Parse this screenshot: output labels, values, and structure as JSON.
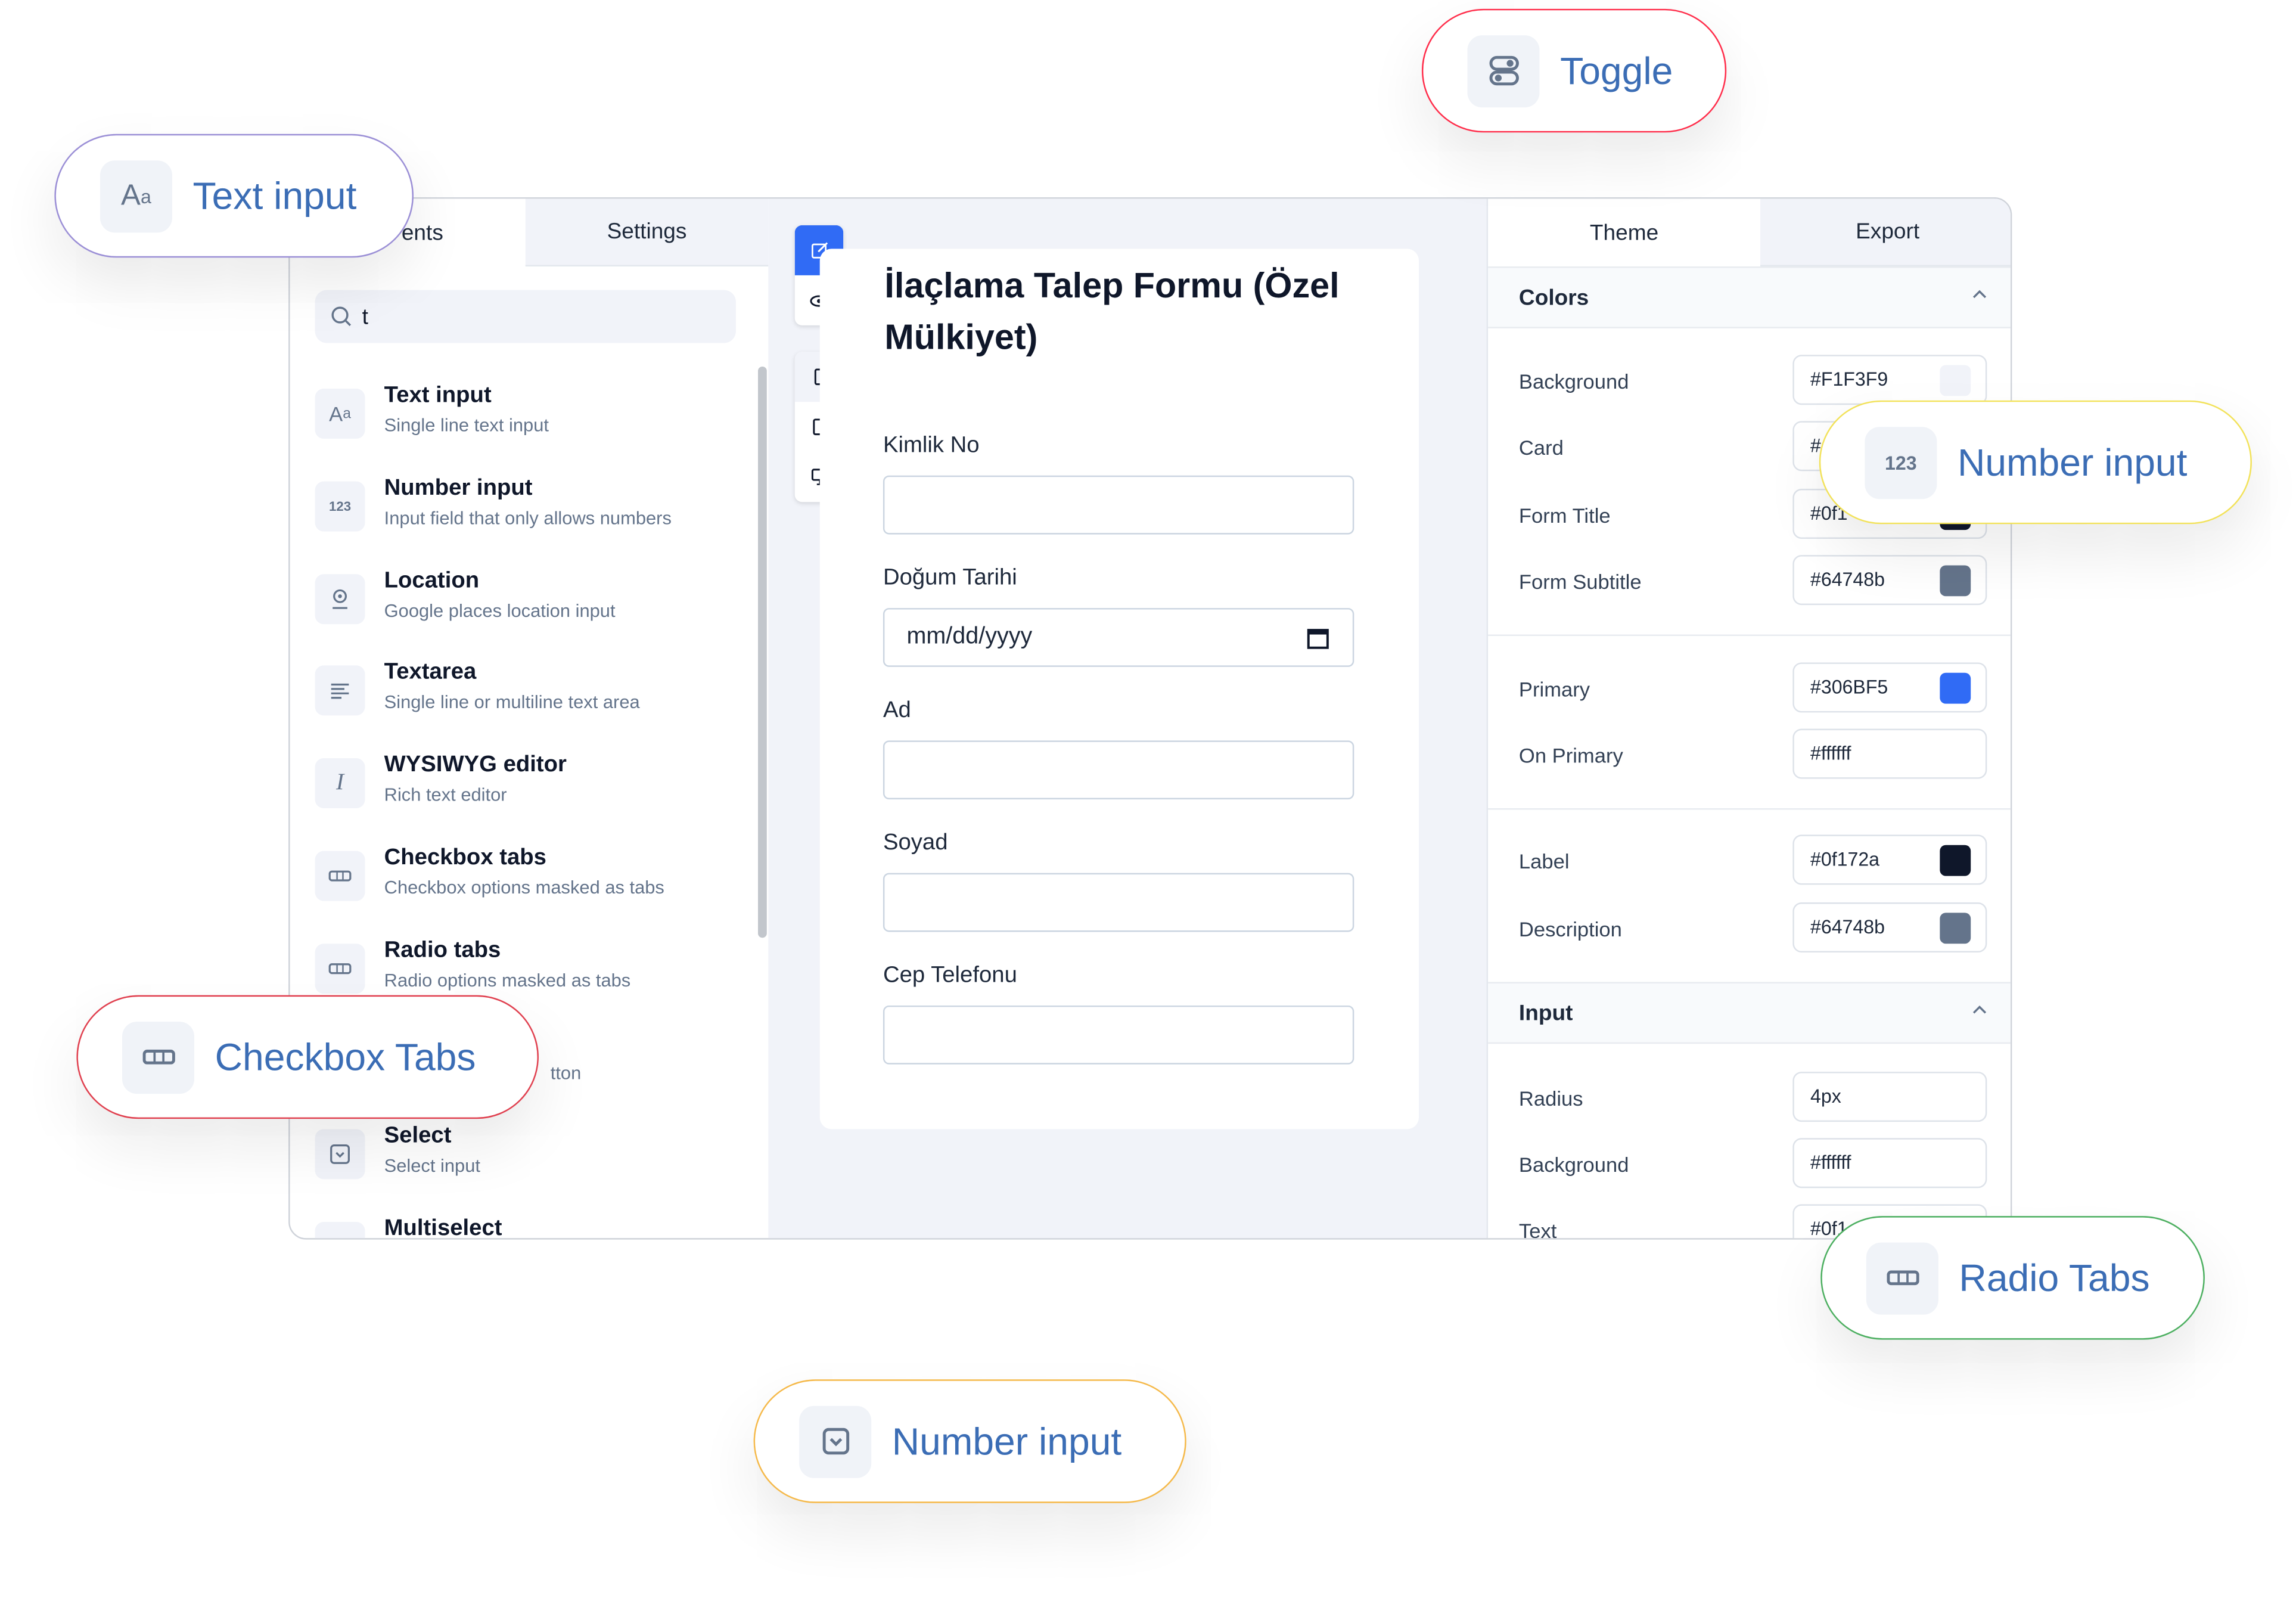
{
  "left_panel": {
    "tabs": [
      {
        "label": "ents"
      },
      {
        "label": "Settings"
      }
    ],
    "search": {
      "value": "t"
    },
    "items": [
      {
        "label": "Text input",
        "desc": "Single line text input",
        "icon": "text-aa-icon"
      },
      {
        "label": "Number input",
        "desc": "Input field that only allows numbers",
        "icon": "number-123-icon"
      },
      {
        "label": "Location",
        "desc": "Google places location input",
        "icon": "location-pin-icon"
      },
      {
        "label": "Textarea",
        "desc": "Single line or multiline text area",
        "icon": "lines-icon"
      },
      {
        "label": "WYSIWYG editor",
        "desc": "Rich text editor",
        "icon": "cursor-icon"
      },
      {
        "label": "Checkbox tabs",
        "desc": "Checkbox options masked as tabs",
        "icon": "tabs-icon"
      },
      {
        "label": "Radio tabs",
        "desc": "Radio options masked as tabs",
        "icon": "tabs-icon"
      },
      {
        "label": "",
        "desc": "tton",
        "icon": ""
      },
      {
        "label": "Select",
        "desc": "Select input",
        "icon": "select-icon"
      },
      {
        "label": "Multiselect",
        "desc": "",
        "icon": "select-icon"
      }
    ]
  },
  "toolbar": {
    "icons": [
      "edit-icon",
      "eye-icon",
      "mobile-icon",
      "tablet-icon",
      "desktop-icon"
    ]
  },
  "form": {
    "title": "İlaçlama Talep Formu (Özel Mülkiyet)",
    "fields": [
      {
        "label": "Kimlik No",
        "value": ""
      },
      {
        "label": "Doğum Tarihi",
        "value": "mm/dd/yyyy"
      },
      {
        "label": "Ad",
        "value": ""
      },
      {
        "label": "Soyad",
        "value": ""
      },
      {
        "label": "Cep Telefonu",
        "value": ""
      }
    ]
  },
  "right_panel": {
    "tabs": [
      {
        "label": "Theme"
      },
      {
        "label": "Export"
      }
    ],
    "colors": {
      "title": "Colors",
      "rows": [
        {
          "label": "Background",
          "value": "#F1F3F9",
          "swatch": "#F1F3F9"
        },
        {
          "label": "Card",
          "value": "#",
          "swatch": "#ffffff"
        },
        {
          "label": "Form Title",
          "value": "#0f1",
          "swatch": "#0f172a"
        },
        {
          "label": "Form Subtitle",
          "value": "#64748b",
          "swatch": "#64748b"
        },
        {
          "label": "Primary",
          "value": "#306BF5",
          "swatch": "#306BF5"
        },
        {
          "label": "On Primary",
          "value": "#ffffff",
          "swatch": "#ffffff"
        },
        {
          "label": "Label",
          "value": "#0f172a",
          "swatch": "#0f172a"
        },
        {
          "label": "Description",
          "value": "#64748b",
          "swatch": "#64748b"
        }
      ]
    },
    "input": {
      "title": "Input",
      "rows": [
        {
          "label": "Radius",
          "value": "4px"
        },
        {
          "label": "Background",
          "value": "#ffffff",
          "swatch": "#ffffff"
        },
        {
          "label": "Text",
          "value": "#0f1"
        }
      ]
    }
  },
  "callouts": [
    {
      "label": "Toggle",
      "icon": "toggle-icon",
      "border": "#ff2d4a"
    },
    {
      "label": "Text input",
      "icon": "text-aa-icon",
      "border": "#9b8fd6"
    },
    {
      "label": "Number input",
      "icon": "number-123-icon",
      "icon_text": "123",
      "border": "#f2e25a"
    },
    {
      "label": "Checkbox Tabs",
      "icon": "tabs-icon",
      "border": "#e0404f"
    },
    {
      "label": "Radio Tabs",
      "icon": "tabs-icon",
      "border": "#4caf60"
    },
    {
      "label": "Number input",
      "icon": "select-icon",
      "border": "#f5b94a"
    }
  ],
  "colors": {
    "primary": "#306BF5",
    "callout_text": "#3b6db5"
  }
}
